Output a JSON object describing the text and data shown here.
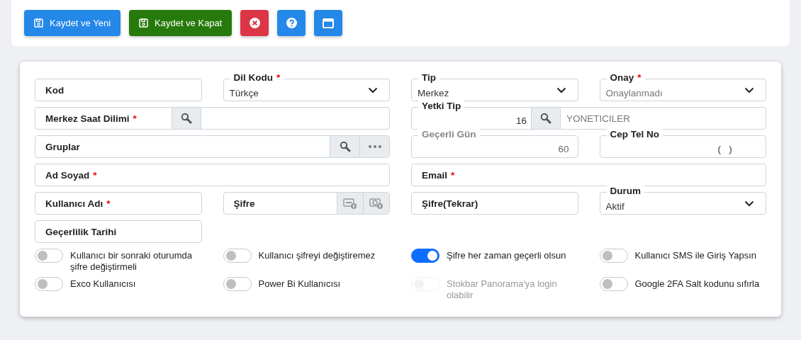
{
  "toolbar": [
    {
      "kind": "save_new",
      "label": "Kaydet ve Yeni"
    },
    {
      "kind": "save_close",
      "label": "Kaydet ve Kapat"
    },
    {
      "kind": "close"
    },
    {
      "kind": "help"
    },
    {
      "kind": "window"
    }
  ],
  "form_rows": [
    [
      {
        "kind": "text",
        "label": "Kod"
      },
      {
        "kind": "select",
        "legend": "Dil Kodu",
        "mark": "*",
        "value": "Türkçe"
      },
      {
        "kind": "select",
        "legend": "Tip",
        "value": "Merkez"
      },
      {
        "kind": "select",
        "legend": "Onay",
        "mark": "*",
        "placeholder": "Onaylanmadı"
      }
    ],
    [
      {
        "kind": "search_lookup",
        "label": "Merkez Saat Dilimi",
        "mark": "*",
        "wide": true
      },
      {
        "kind": "code_lookup",
        "legend": "Yetki Tip",
        "value": "16",
        "description": "YONETICILER",
        "wide": true
      }
    ],
    [
      {
        "kind": "multi_lookup",
        "label": "Gruplar",
        "wide": true
      },
      {
        "kind": "number",
        "legend": "Geçerli Gün",
        "value": "60",
        "disabled": true
      },
      {
        "kind": "number",
        "legend": "Cep Tel No",
        "value": "(   )",
        "disabled": false
      }
    ],
    [
      {
        "kind": "text",
        "label": "Ad Soyad",
        "mark": "*",
        "wide": true
      },
      {
        "kind": "text",
        "label": "Email",
        "mark": "*",
        "wide": true
      }
    ],
    [
      {
        "kind": "text",
        "label": "Kullanıcı Adı",
        "mark": "*"
      },
      {
        "kind": "password",
        "label": "Şifre"
      },
      {
        "kind": "text",
        "label": "Şifre(Tekrar)"
      },
      {
        "kind": "select",
        "legend": "Durum",
        "value": "Aktif"
      }
    ],
    [
      {
        "kind": "text",
        "label": "Geçerlilik Tarihi"
      }
    ]
  ],
  "toggles": [
    {
      "label": "Kullanıcı bir sonraki oturumda şifre değiştirmeli",
      "on": false,
      "disabled": false
    },
    {
      "label": "Kullanıcı şifreyi değiştiremez",
      "on": false,
      "disabled": false
    },
    {
      "label": "Şifre her zaman geçerli olsun",
      "on": true,
      "disabled": false
    },
    {
      "label": "Kullanıcı SMS ile Giriş Yapsın",
      "on": false,
      "disabled": false
    },
    {
      "label": "Exco Kullanıcısı",
      "on": false,
      "disabled": false
    },
    {
      "label": "Power Bi Kullanıcısı",
      "on": false,
      "disabled": false
    },
    {
      "label": "Stokbar Panorama'ya login olabilir",
      "on": false,
      "disabled": true
    },
    {
      "label": "Google 2FA Salt kodunu sıfırla",
      "on": false,
      "disabled": false
    }
  ]
}
